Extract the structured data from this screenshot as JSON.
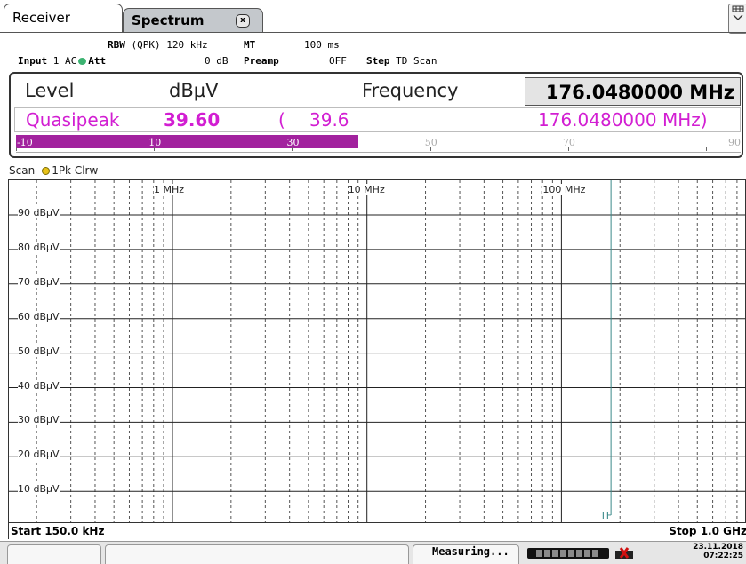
{
  "tabs": {
    "receiver": "Receiver",
    "spectrum": "Spectrum",
    "spectrum_close": "x"
  },
  "menu_icon": "window-menu-icon",
  "info": {
    "rbw_label": "RBW",
    "rbw_value": "(QPK) 120 kHz",
    "mt_label": "MT",
    "mt_value": "100 ms",
    "input_label": "Input",
    "input_value": "1 AC",
    "att_label": "Att",
    "att_value": "0 dB",
    "preamp_label": "Preamp",
    "preamp_value": "OFF",
    "step_label": "Step",
    "step_value": "TD Scan"
  },
  "level_panel": {
    "level_label": "Level",
    "unit": "dBµV",
    "frequency_label": "Frequency",
    "frequency_value": "176.0480000 MHz",
    "detector": "Quasipeak",
    "level_value": "39.60",
    "paren_open": "(",
    "peak_value": "39.6",
    "peak_frequency": "176.0480000 MHz)",
    "bar_level": 39.6,
    "bar_ticks": [
      "-10",
      "10",
      "30",
      "50",
      "70",
      "90"
    ],
    "bar_range": [
      -10,
      95
    ]
  },
  "trace": {
    "scan_label": "Scan",
    "trace_label": "1Pk Clrw"
  },
  "graph": {
    "y_labels": [
      "90 dBµV",
      "80 dBµV",
      "70 dBµV",
      "60 dBµV",
      "50 dBµV",
      "40 dBµV",
      "30 dBµV",
      "20 dBµV",
      "10 dBµV"
    ],
    "x_labels": [
      "1 MHz",
      "10 MHz",
      "100 MHz"
    ],
    "marker_label": "TF",
    "start": "Start 150.0 kHz",
    "stop": "Stop 1.0 GHz"
  },
  "status": {
    "measuring": "Measuring...",
    "date": "23.11.2018",
    "time": "07:22:25"
  },
  "colors": {
    "accent_magenta": "#d21ed2",
    "bar_fill": "#a2229e",
    "marker_line": "#3b8a8a"
  }
}
